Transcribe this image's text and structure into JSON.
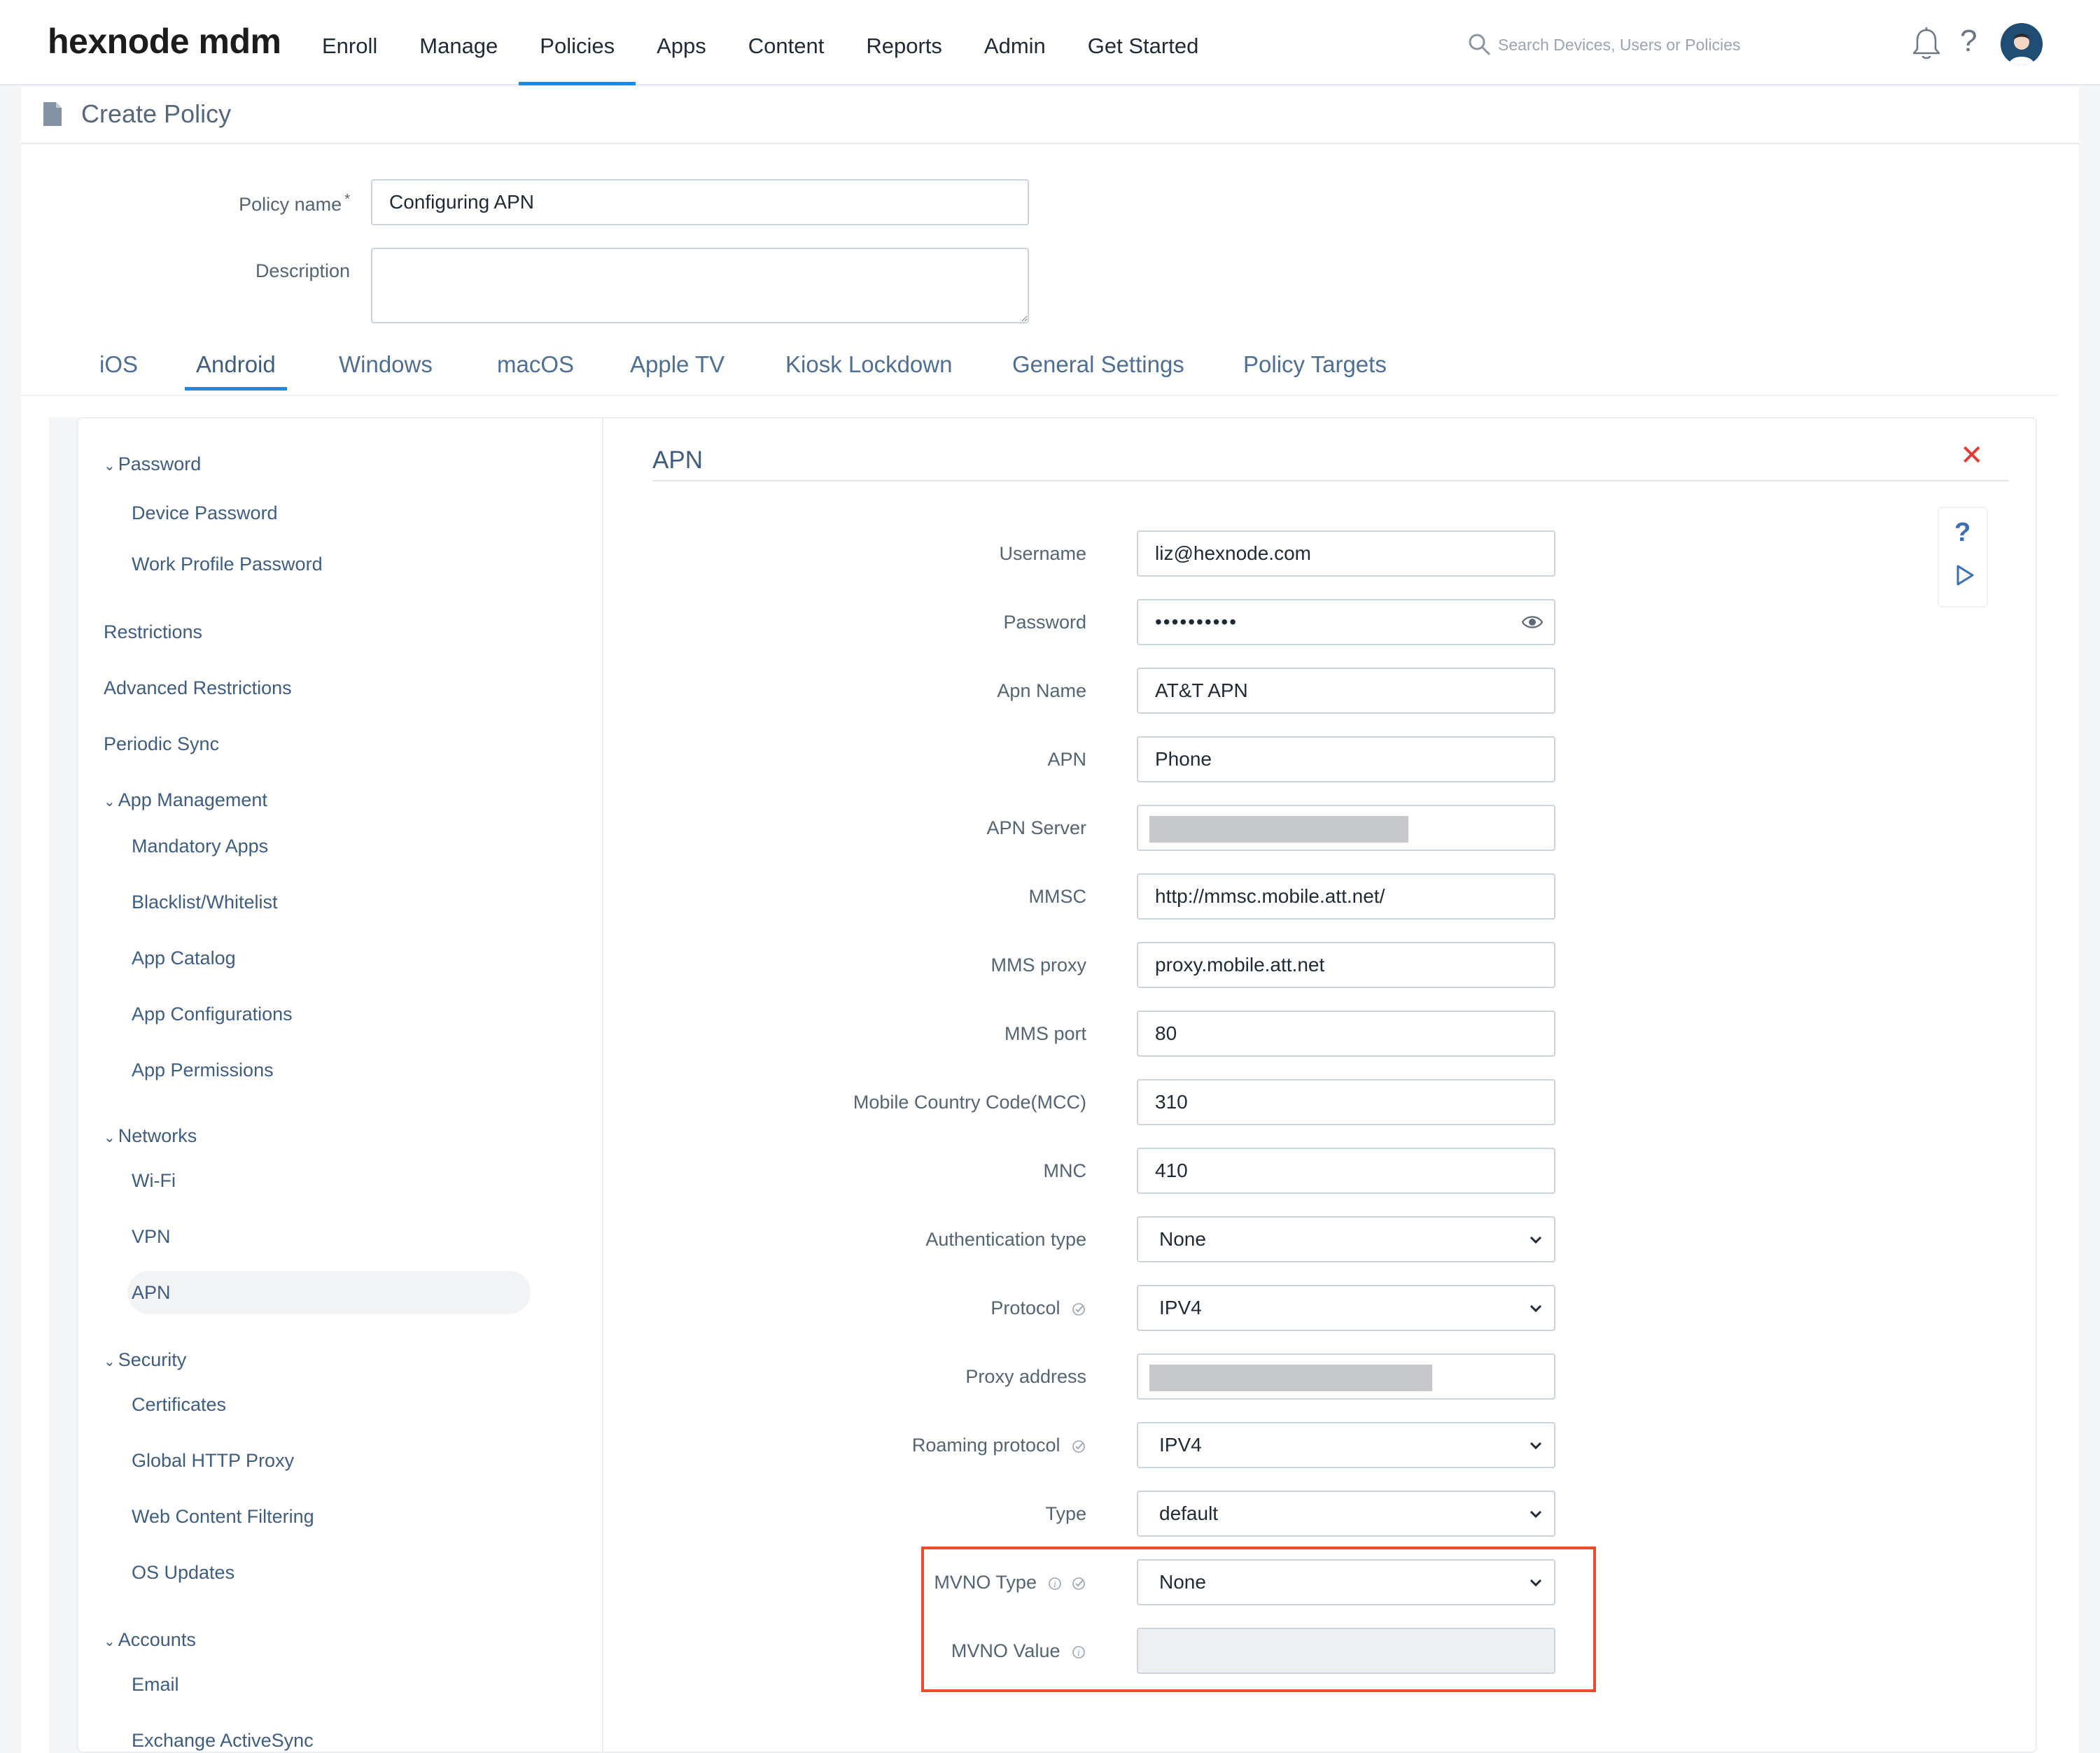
{
  "app": {
    "logo": "hexnode mdm",
    "nav": [
      "Enroll",
      "Manage",
      "Policies",
      "Apps",
      "Content",
      "Reports",
      "Admin",
      "Get Started"
    ],
    "active_nav": "Policies",
    "search_placeholder": "Search Devices, Users or Policies",
    "help_glyph": "?"
  },
  "page": {
    "title": "Create Policy",
    "policy_name_label": "Policy name",
    "required_mark": "*",
    "policy_name_value": "Configuring APN",
    "description_label": "Description",
    "description_value": ""
  },
  "tabs": [
    "iOS",
    "Android",
    "Windows",
    "macOS",
    "Apple TV",
    "Kiosk Lockdown",
    "General Settings",
    "Policy Targets"
  ],
  "active_tab": "Android",
  "sidebar": {
    "sections": [
      {
        "label": "Password",
        "items": [
          "Device Password",
          "Work Profile Password"
        ]
      },
      {
        "label": "Restrictions",
        "items": []
      },
      {
        "label": "Advanced Restrictions",
        "items": []
      },
      {
        "label": "Periodic Sync",
        "items": []
      },
      {
        "label": "App Management",
        "items": [
          "Mandatory Apps",
          "Blacklist/Whitelist",
          "App Catalog",
          "App Configurations",
          "App Permissions"
        ]
      },
      {
        "label": "Networks",
        "items": [
          "Wi-Fi",
          "VPN",
          "APN"
        ]
      },
      {
        "label": "Security",
        "items": [
          "Certificates",
          "Global HTTP Proxy",
          "Web Content Filtering",
          "OS Updates"
        ]
      },
      {
        "label": "Accounts",
        "items": [
          "Email",
          "Exchange ActiveSync"
        ]
      }
    ],
    "active_item": "APN"
  },
  "panel": {
    "title": "APN",
    "close_glyph": "✕",
    "help_glyph": "?",
    "fields": {
      "username": {
        "label": "Username",
        "value": "liz@hexnode.com"
      },
      "password": {
        "label": "Password",
        "value": "••••••••••"
      },
      "apn_name": {
        "label": "Apn Name",
        "value": "AT&T APN"
      },
      "apn": {
        "label": "APN",
        "value": "Phone"
      },
      "apn_server": {
        "label": "APN Server",
        "value": ""
      },
      "mmsc": {
        "label": "MMSC",
        "value": "http://mmsc.mobile.att.net/"
      },
      "mms_proxy": {
        "label": "MMS proxy",
        "value": "proxy.mobile.att.net"
      },
      "mms_port": {
        "label": "MMS port",
        "value": "80"
      },
      "mcc": {
        "label": "Mobile Country Code(MCC)",
        "value": "310"
      },
      "mnc": {
        "label": "MNC",
        "value": "410"
      },
      "auth_type": {
        "label": "Authentication type",
        "value": "None"
      },
      "protocol": {
        "label": "Protocol",
        "value": "IPV4"
      },
      "proxy_address": {
        "label": "Proxy address",
        "value": ""
      },
      "roaming_protocol": {
        "label": "Roaming protocol",
        "value": "IPV4"
      },
      "type": {
        "label": "Type",
        "value": "default"
      },
      "mvno_type": {
        "label": "MVNO Type",
        "value": "None"
      },
      "mvno_value": {
        "label": "MVNO Value",
        "value": ""
      }
    }
  },
  "colors": {
    "accent": "#1e88e5",
    "link": "#3e5d80",
    "close": "#e53935",
    "highlight": "#f04a2c"
  }
}
